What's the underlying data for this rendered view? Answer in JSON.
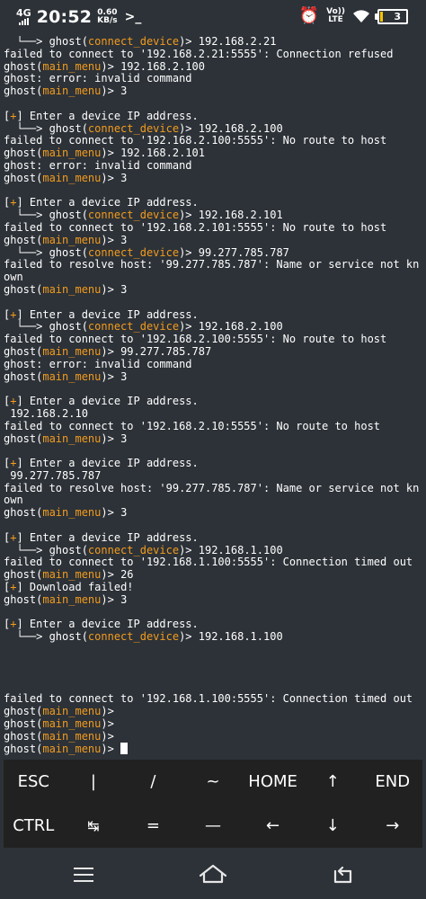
{
  "status_bar": {
    "network": "4G",
    "time": "20:52",
    "speed_value": "0.60",
    "speed_unit": "KB/s",
    "prompt_icon": "terminal-prompt-icon",
    "volte_top": "Vo))",
    "volte_bottom": "LTE",
    "battery_level": "3"
  },
  "terminal": {
    "prompt_name": "ghost",
    "lines": [
      [
        {
          "t": "  └──> ghost(",
          "c": ""
        },
        {
          "t": "connect_device",
          "c": "orange"
        },
        {
          "t": ")> 192.168.2.21",
          "c": ""
        }
      ],
      [
        {
          "t": "failed to connect to '192.168.2.21:5555': Connection refused",
          "c": ""
        }
      ],
      [
        {
          "t": "ghost(",
          "c": ""
        },
        {
          "t": "main_menu",
          "c": "orange"
        },
        {
          "t": ")> 192.168.2.100",
          "c": ""
        }
      ],
      [
        {
          "t": "ghost: error: invalid command",
          "c": ""
        }
      ],
      [
        {
          "t": "ghost(",
          "c": ""
        },
        {
          "t": "main_menu",
          "c": "orange"
        },
        {
          "t": ")> 3",
          "c": ""
        }
      ],
      [],
      [
        {
          "t": "[",
          "c": ""
        },
        {
          "t": "+",
          "c": "orange"
        },
        {
          "t": "] Enter a device IP address.",
          "c": ""
        }
      ],
      [
        {
          "t": "  └──> ghost(",
          "c": ""
        },
        {
          "t": "connect_device",
          "c": "orange"
        },
        {
          "t": ")> 192.168.2.100",
          "c": ""
        }
      ],
      [
        {
          "t": "failed to connect to '192.168.2.100:5555': No route to host",
          "c": ""
        }
      ],
      [
        {
          "t": "ghost(",
          "c": ""
        },
        {
          "t": "main_menu",
          "c": "orange"
        },
        {
          "t": ")> 192.168.2.101",
          "c": ""
        }
      ],
      [
        {
          "t": "ghost: error: invalid command",
          "c": ""
        }
      ],
      [
        {
          "t": "ghost(",
          "c": ""
        },
        {
          "t": "main_menu",
          "c": "orange"
        },
        {
          "t": ")> 3",
          "c": ""
        }
      ],
      [],
      [
        {
          "t": "[",
          "c": ""
        },
        {
          "t": "+",
          "c": "orange"
        },
        {
          "t": "] Enter a device IP address.",
          "c": ""
        }
      ],
      [
        {
          "t": "  └──> ghost(",
          "c": ""
        },
        {
          "t": "connect_device",
          "c": "orange"
        },
        {
          "t": ")> 192.168.2.101",
          "c": ""
        }
      ],
      [
        {
          "t": "failed to connect to '192.168.2.101:5555': No route to host",
          "c": ""
        }
      ],
      [
        {
          "t": "ghost(",
          "c": ""
        },
        {
          "t": "main_menu",
          "c": "orange"
        },
        {
          "t": ")> 3",
          "c": ""
        }
      ],
      [
        {
          "t": "  └──> ghost(",
          "c": ""
        },
        {
          "t": "connect_device",
          "c": "orange"
        },
        {
          "t": ")> 99.277.785.787",
          "c": ""
        }
      ],
      [
        {
          "t": "failed to resolve host: '99.277.785.787': Name or service not kn",
          "c": ""
        }
      ],
      [
        {
          "t": "own",
          "c": ""
        }
      ],
      [
        {
          "t": "ghost(",
          "c": ""
        },
        {
          "t": "main_menu",
          "c": "orange"
        },
        {
          "t": ")> 3",
          "c": ""
        }
      ],
      [],
      [
        {
          "t": "[",
          "c": ""
        },
        {
          "t": "+",
          "c": "orange"
        },
        {
          "t": "] Enter a device IP address.",
          "c": ""
        }
      ],
      [
        {
          "t": "  └──> ghost(",
          "c": ""
        },
        {
          "t": "connect_device",
          "c": "orange"
        },
        {
          "t": ")> 192.168.2.100",
          "c": ""
        }
      ],
      [
        {
          "t": "failed to connect to '192.168.2.100:5555': No route to host",
          "c": ""
        }
      ],
      [
        {
          "t": "ghost(",
          "c": ""
        },
        {
          "t": "main_menu",
          "c": "orange"
        },
        {
          "t": ")> 99.277.785.787",
          "c": ""
        }
      ],
      [
        {
          "t": "ghost: error: invalid command",
          "c": ""
        }
      ],
      [
        {
          "t": "ghost(",
          "c": ""
        },
        {
          "t": "main_menu",
          "c": "orange"
        },
        {
          "t": ")> 3",
          "c": ""
        }
      ],
      [],
      [
        {
          "t": "[",
          "c": ""
        },
        {
          "t": "+",
          "c": "orange"
        },
        {
          "t": "] Enter a device IP address.",
          "c": ""
        }
      ],
      [
        {
          "t": " 192.168.2.10",
          "c": ""
        }
      ],
      [
        {
          "t": "failed to connect to '192.168.2.10:5555': No route to host",
          "c": ""
        }
      ],
      [
        {
          "t": "ghost(",
          "c": ""
        },
        {
          "t": "main_menu",
          "c": "orange"
        },
        {
          "t": ")> 3",
          "c": ""
        }
      ],
      [],
      [
        {
          "t": "[",
          "c": ""
        },
        {
          "t": "+",
          "c": "orange"
        },
        {
          "t": "] Enter a device IP address.",
          "c": ""
        }
      ],
      [
        {
          "t": " 99.277.785.787",
          "c": ""
        }
      ],
      [
        {
          "t": "failed to resolve host: '99.277.785.787': Name or service not kn",
          "c": ""
        }
      ],
      [
        {
          "t": "own",
          "c": ""
        }
      ],
      [
        {
          "t": "ghost(",
          "c": ""
        },
        {
          "t": "main_menu",
          "c": "orange"
        },
        {
          "t": ")> 3",
          "c": ""
        }
      ],
      [],
      [
        {
          "t": "[",
          "c": ""
        },
        {
          "t": "+",
          "c": "orange"
        },
        {
          "t": "] Enter a device IP address.",
          "c": ""
        }
      ],
      [
        {
          "t": "  └──> ghost(",
          "c": ""
        },
        {
          "t": "connect_device",
          "c": "orange"
        },
        {
          "t": ")> 192.168.1.100",
          "c": ""
        }
      ],
      [
        {
          "t": "failed to connect to '192.168.1.100:5555': Connection timed out",
          "c": ""
        }
      ],
      [
        {
          "t": "ghost(",
          "c": ""
        },
        {
          "t": "main_menu",
          "c": "orange"
        },
        {
          "t": ")> 26",
          "c": ""
        }
      ],
      [
        {
          "t": "[",
          "c": ""
        },
        {
          "t": "+",
          "c": "orange"
        },
        {
          "t": "] Download failed!",
          "c": ""
        }
      ],
      [
        {
          "t": "ghost(",
          "c": ""
        },
        {
          "t": "main_menu",
          "c": "orange"
        },
        {
          "t": ")> 3",
          "c": ""
        }
      ],
      [],
      [
        {
          "t": "[",
          "c": ""
        },
        {
          "t": "+",
          "c": "orange"
        },
        {
          "t": "] Enter a device IP address.",
          "c": ""
        }
      ],
      [
        {
          "t": "  └──> ghost(",
          "c": ""
        },
        {
          "t": "connect_device",
          "c": "orange"
        },
        {
          "t": ")> 192.168.1.100",
          "c": ""
        }
      ],
      [],
      [],
      [],
      [],
      [
        {
          "t": "failed to connect to '192.168.1.100:5555': Connection timed out",
          "c": ""
        }
      ],
      [
        {
          "t": "ghost(",
          "c": ""
        },
        {
          "t": "main_menu",
          "c": "orange"
        },
        {
          "t": ")>",
          "c": ""
        }
      ],
      [
        {
          "t": "ghost(",
          "c": ""
        },
        {
          "t": "main_menu",
          "c": "orange"
        },
        {
          "t": ")>",
          "c": ""
        }
      ],
      [
        {
          "t": "ghost(",
          "c": ""
        },
        {
          "t": "main_menu",
          "c": "orange"
        },
        {
          "t": ")>",
          "c": ""
        }
      ],
      [
        {
          "t": "ghost(",
          "c": ""
        },
        {
          "t": "main_menu",
          "c": "orange"
        },
        {
          "t": ")> ",
          "c": ""
        }
      ]
    ]
  },
  "extra_keys": {
    "row1": [
      "ESC",
      "|",
      "/",
      "~",
      "HOME",
      "↑",
      "END"
    ],
    "row2": [
      "CTRL",
      "↹",
      "=",
      "—",
      "←",
      "↓",
      "→"
    ]
  },
  "colors": {
    "background": "#2d3238",
    "accent": "#f29b1d",
    "keys_background": "#212121"
  },
  "nav_bar": {
    "menu_icon": "menu-icon",
    "home_icon": "home-icon",
    "back_icon": "back-icon"
  }
}
